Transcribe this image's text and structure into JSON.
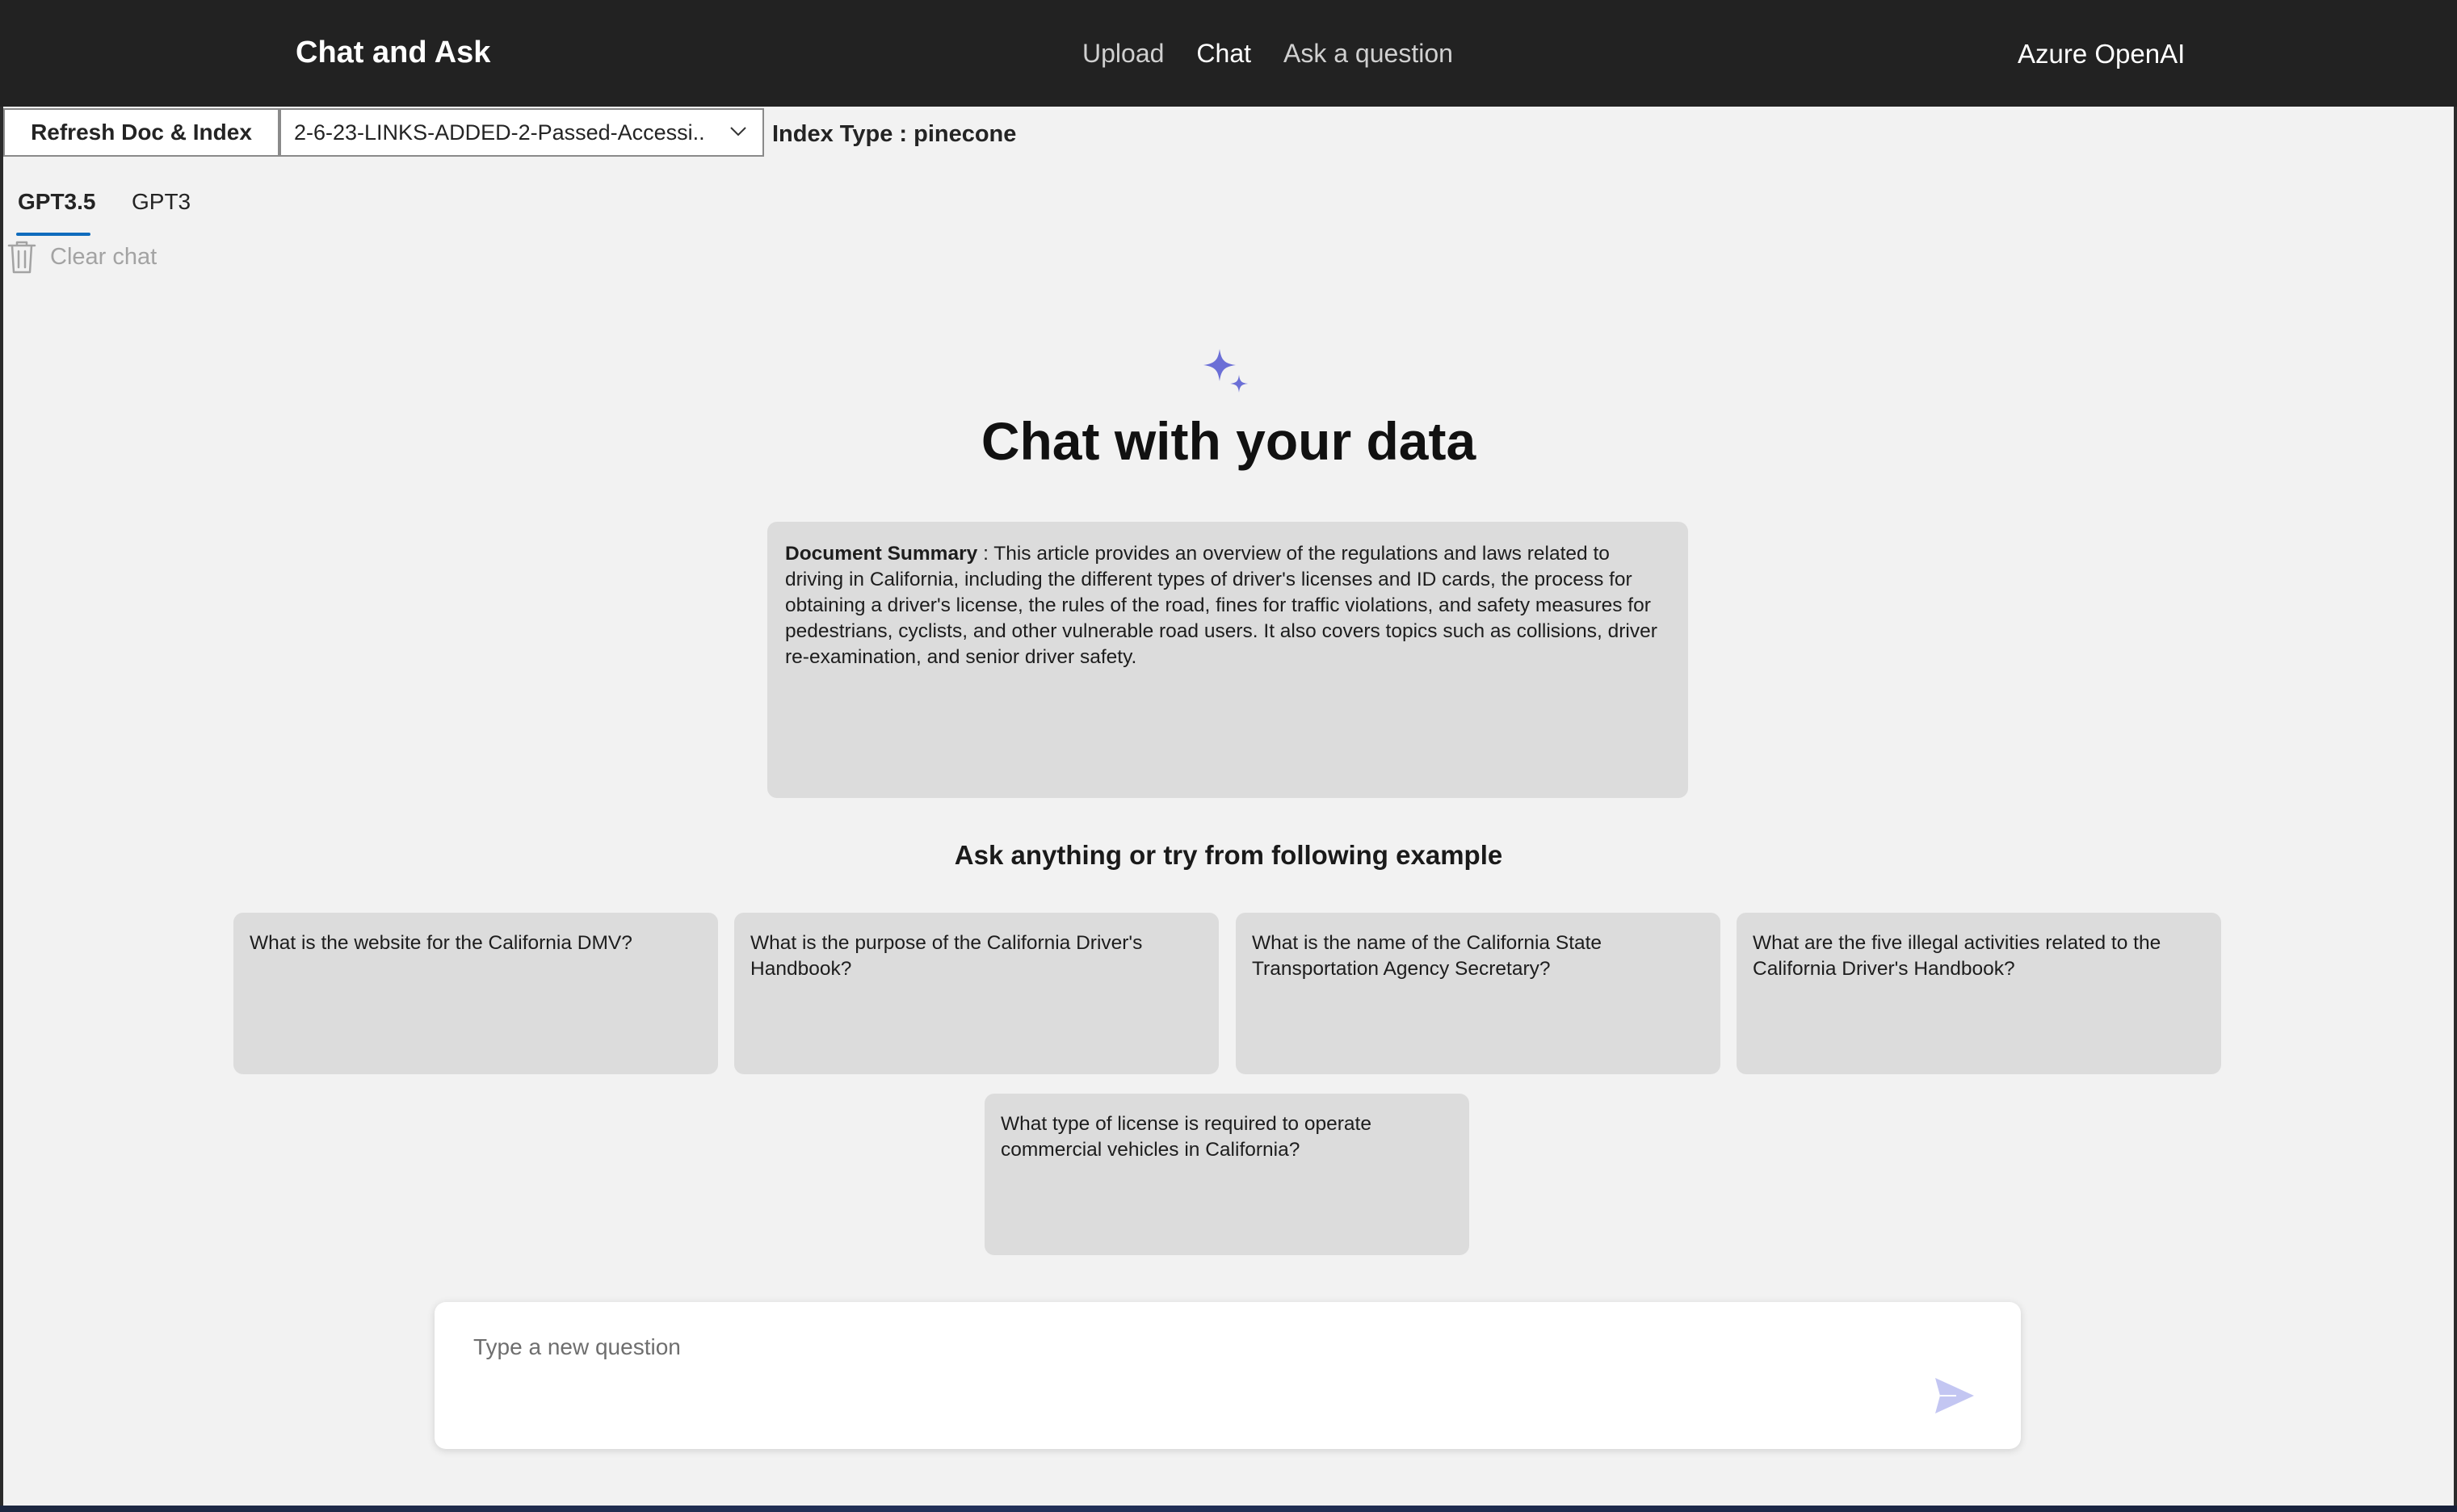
{
  "header": {
    "brand": "Chat and Ask",
    "nav": [
      {
        "label": "Upload",
        "active": false
      },
      {
        "label": "Chat",
        "active": true
      },
      {
        "label": "Ask a question",
        "active": false
      }
    ],
    "right": "Azure OpenAI"
  },
  "toolbar": {
    "refresh_label": "Refresh Doc & Index",
    "document_selected": "2-6-23-LINKS-ADDED-2-Passed-Accessi...",
    "index_type": "Index Type : pinecone"
  },
  "tabs": [
    {
      "label": "GPT3.5",
      "selected": true
    },
    {
      "label": "GPT3",
      "selected": false
    }
  ],
  "clear_chat": "Clear chat",
  "hero": {
    "title": "Chat with your data"
  },
  "summary": {
    "label": "Document Summary",
    "separator": " : ",
    "text": "This article provides an overview of the regulations and laws related to driving in California, including the different types of driver's licenses and ID cards, the process for obtaining a driver's license, the rules of the road, fines for traffic violations, and safety measures for pedestrians, cyclists, and other vulnerable road users. It also covers topics such as collisions, driver re-examination, and senior driver safety."
  },
  "examples_heading": "Ask anything or try from following example",
  "examples": [
    "What is the website for the California DMV?",
    "What is the purpose of the California Driver's Handbook?",
    "What is the name of the California State Transportation Agency Secretary?",
    "What are the five illegal activities related to the California Driver's Handbook?",
    "What type of license is required to operate commercial vehicles in California?"
  ],
  "question": {
    "placeholder": "Type a new question",
    "value": ""
  },
  "colors": {
    "header_bg": "#222222",
    "accent": "#0f6cbd",
    "sparkle": "#6b6fd6",
    "card_bg": "#dcdcdc"
  },
  "icons": {
    "clear": "trash-icon",
    "hero": "sparkle-icon",
    "send": "send-icon",
    "select": "chevron-down-icon"
  }
}
